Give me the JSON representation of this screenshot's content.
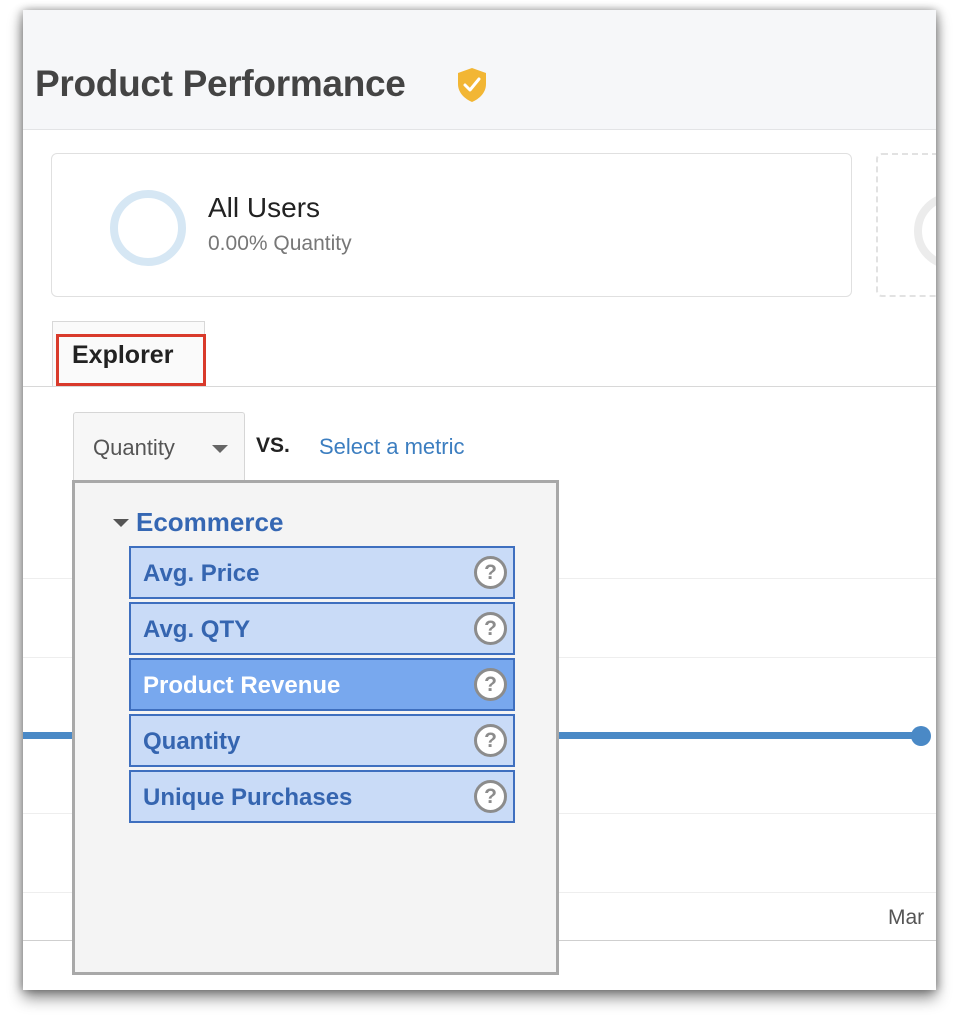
{
  "header": {
    "title": "Product Performance",
    "verified_icon": "verified-shield-check-icon",
    "verified_color": "#f2b634"
  },
  "segments": [
    {
      "name": "All Users",
      "metric": "0.00% Quantity",
      "ring_color": "#d6e7f4"
    },
    {
      "name": "",
      "metric": "",
      "placeholder": true
    }
  ],
  "tabs": [
    {
      "label": "Explorer",
      "active": true,
      "highlighted": true,
      "highlight_color": "#d93a2b"
    }
  ],
  "metric_selector": {
    "selected": "Quantity",
    "vs_label": "VS.",
    "compare_link": "Select a metric"
  },
  "metric_dropdown": {
    "group": "Ecommerce",
    "items": [
      {
        "label": "Avg. Price",
        "active": false,
        "help": "?"
      },
      {
        "label": "Avg. QTY",
        "active": false,
        "help": "?"
      },
      {
        "label": "Product Revenue",
        "active": true,
        "help": "?"
      },
      {
        "label": "Quantity",
        "active": false,
        "help": "?"
      },
      {
        "label": "Unique Purchases",
        "active": false,
        "help": "?"
      }
    ]
  },
  "chart": {
    "series_color": "#4a89c6",
    "x_tick_label": "Mar"
  }
}
